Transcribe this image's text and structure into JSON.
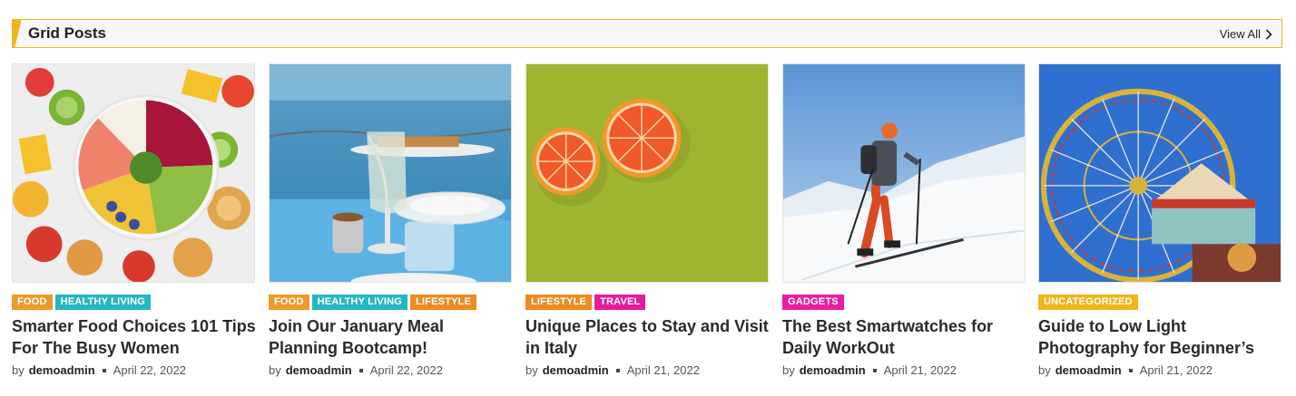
{
  "section": {
    "title": "Grid Posts",
    "view_all": "View All",
    "accent_color": "#f0b51c"
  },
  "category_colors": {
    "FOOD": "#ec9b2a",
    "HEALTHY LIVING": "#24b8c3",
    "LIFESTYLE": "#ec8b22",
    "TRAVEL": "#e81a9c",
    "GADGETS": "#e91ea0",
    "UNCATEGORIZED": "#f0b51c"
  },
  "posts": [
    {
      "image": "fruit-bowl-image",
      "categories": [
        "FOOD",
        "HEALTHY LIVING"
      ],
      "title": "Smarter Food Choices 101 Tips For The Busy Women",
      "by": "by",
      "author": "demoadmin",
      "date": "April 22, 2022"
    },
    {
      "image": "seaside-table-image",
      "categories": [
        "FOOD",
        "HEALTHY LIVING",
        "LIFESTYLE"
      ],
      "title": "Join Our January Meal Planning Bootcamp!",
      "by": "by",
      "author": "demoadmin",
      "date": "April 22, 2022"
    },
    {
      "image": "grapefruit-image",
      "categories": [
        "LIFESTYLE",
        "TRAVEL"
      ],
      "title": "Unique Places to Stay and Visit in Italy",
      "by": "by",
      "author": "demoadmin",
      "date": "April 21, 2022"
    },
    {
      "image": "ski-tour-image",
      "categories": [
        "GADGETS"
      ],
      "title": "The Best Smartwatches for Daily WorkOut",
      "by": "by",
      "author": "demoadmin",
      "date": "April 21, 2022"
    },
    {
      "image": "ferris-wheel-image",
      "categories": [
        "UNCATEGORIZED"
      ],
      "title": "Guide to Low Light Photography for Beginner’s",
      "by": "by",
      "author": "demoadmin",
      "date": "April 21, 2022"
    }
  ]
}
